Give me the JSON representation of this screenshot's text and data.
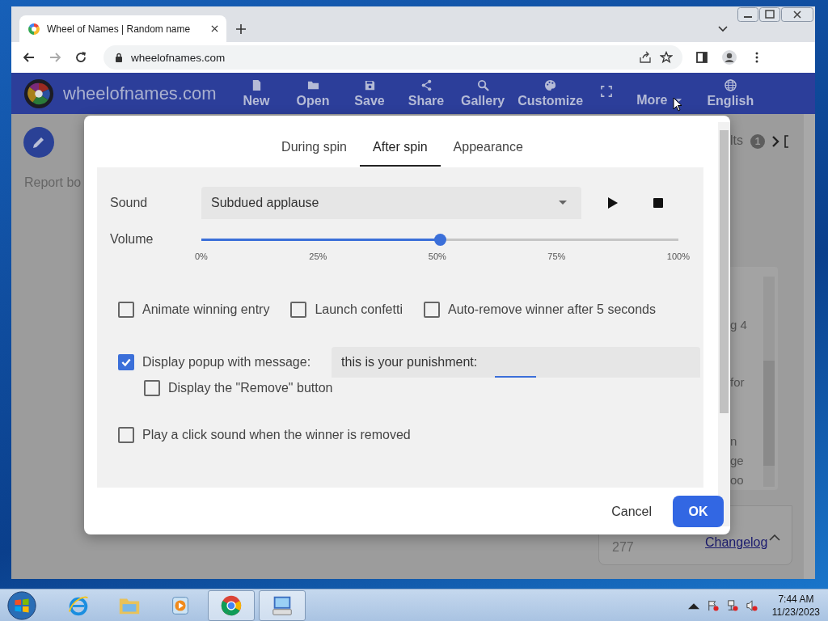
{
  "browser": {
    "tab_title": "Wheel of Names | Random name",
    "url": "wheelofnames.com"
  },
  "site": {
    "logo_text": "wheelofnames.com",
    "nav": [
      "New",
      "Open",
      "Save",
      "Share",
      "Gallery",
      "Customize"
    ],
    "more": "More",
    "language": "English"
  },
  "background": {
    "report": "Report bo",
    "results_label": "lts",
    "results_count": "1",
    "list_fragments": [
      "g 4",
      "for",
      "n",
      "ge",
      "oo"
    ],
    "changelog": "Changelog",
    "entry": "277"
  },
  "dialog": {
    "tabs": [
      {
        "label": "During spin",
        "selected": false
      },
      {
        "label": "After spin",
        "selected": true
      },
      {
        "label": "Appearance",
        "selected": false
      }
    ],
    "sound": {
      "label": "Sound",
      "value": "Subdued applause"
    },
    "volume": {
      "label": "Volume",
      "level": 0.5,
      "ticks": [
        "0%",
        "25%",
        "50%",
        "75%",
        "100%"
      ]
    },
    "options": [
      {
        "label": "Animate winning entry",
        "checked": false
      },
      {
        "label": "Launch confetti",
        "checked": false
      },
      {
        "label": "Auto-remove winner after 5 seconds",
        "checked": false
      }
    ],
    "popup": {
      "label": "Display popup with message:",
      "checked": true,
      "message": "this is your punishment:"
    },
    "remove_button": {
      "label": "Display the \"Remove\" button",
      "checked": false
    },
    "click_sound": {
      "label": "Play a click sound when the winner is removed",
      "checked": false
    },
    "buttons": {
      "cancel": "Cancel",
      "ok": "OK"
    }
  },
  "taskbar": {
    "apps": [
      {
        "selected": false
      },
      {
        "selected": false
      },
      {
        "selected": false
      },
      {
        "selected": true
      },
      {
        "selected": true
      }
    ],
    "time": "7:44 AM",
    "date": "11/23/2023"
  }
}
